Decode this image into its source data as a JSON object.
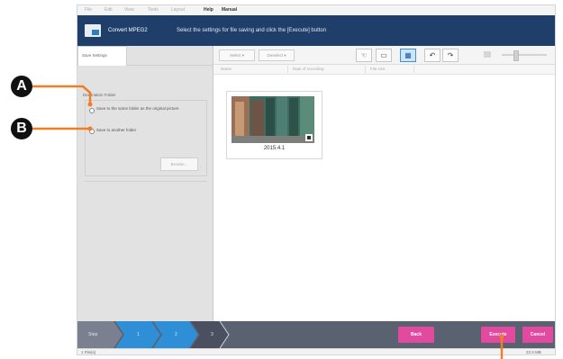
{
  "menubar": {
    "items": [
      "File",
      "Edit",
      "View",
      "Tools",
      "Layout"
    ],
    "help": "Help",
    "manual": "Manual"
  },
  "titlebar": {
    "app_title": "Convert MPEG2",
    "instruction": "Select the settings for file saving and click the [Execute] button"
  },
  "left_panel": {
    "tab_label": "Save Settings",
    "group_label": "Destination Folder",
    "option_a_label": "Save to the same folder as the original picture",
    "option_b_label": "Save to another folder",
    "browse_label": "Browse..."
  },
  "toolbar": {
    "btn1_label": "Select ▾",
    "btn2_label": "Deselect ▾"
  },
  "column_headers": [
    "Name",
    "Date of recording",
    "File size"
  ],
  "thumbnail": {
    "caption": "2015.4.1"
  },
  "steps": {
    "label": "Step",
    "nums": [
      "1",
      "2",
      "3"
    ]
  },
  "buttons": {
    "back": "Back",
    "execute": "Execute",
    "cancel": "Cancel"
  },
  "statusbar": {
    "left": "1 File(s)",
    "right": "23.3 MB"
  },
  "callouts": {
    "a": "A",
    "b": "B"
  },
  "colors": {
    "accent_pink": "#e24aa0",
    "title_bg": "#1f3f6a",
    "step_bar": "#5a6170",
    "step_arrow": "#2f8fd6",
    "callout_line": "#f07e25"
  }
}
